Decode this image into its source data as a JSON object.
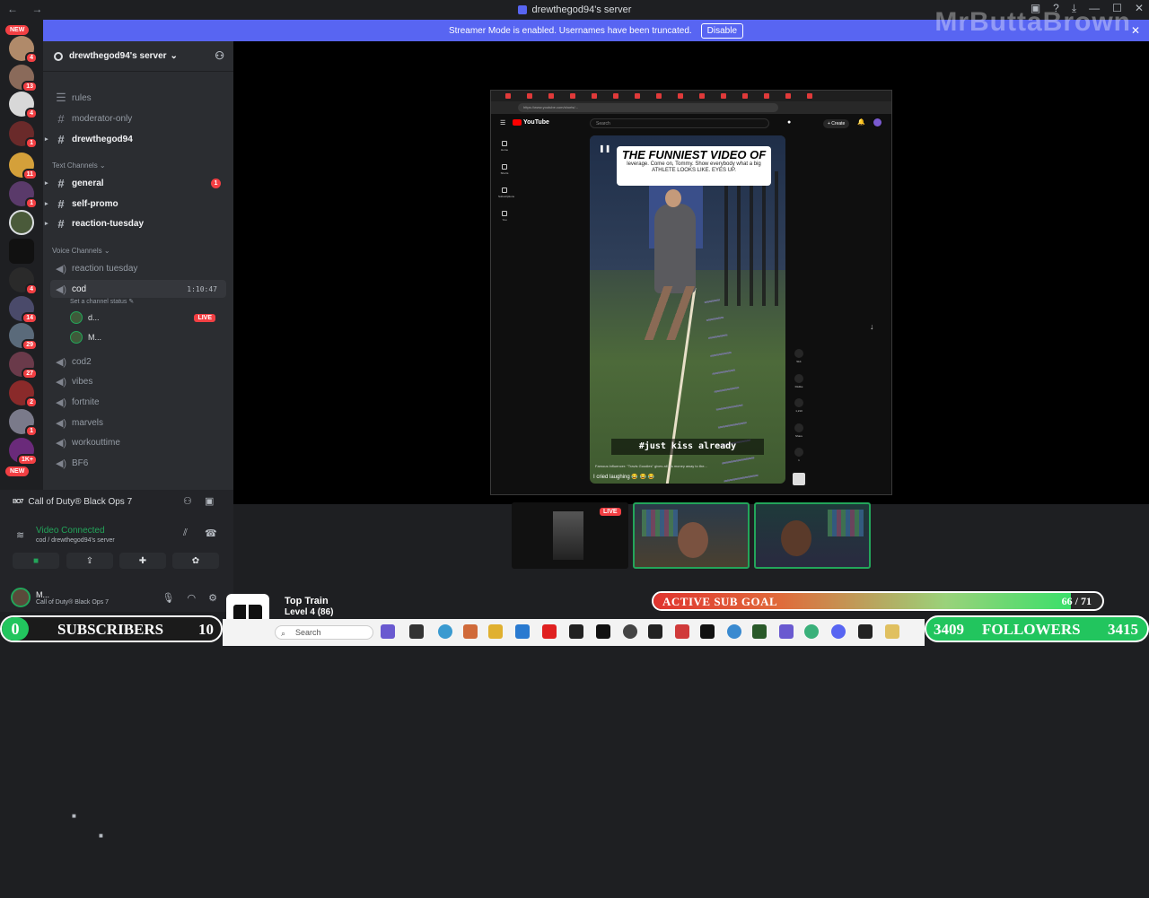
{
  "window": {
    "title": "drewthegod94's server",
    "nav": "← →",
    "controls": [
      "▣",
      "?",
      "⤓",
      "—",
      "☐",
      "✕"
    ]
  },
  "banner": {
    "text": "Streamer Mode is enabled. Usernames have been truncated.",
    "button": "Disable",
    "close": "✕",
    "watermark": "MrButtaBrown"
  },
  "rail": {
    "new_top": "NEW",
    "new_bottom": "NEW",
    "badges": [
      "4",
      "13",
      "4",
      "1",
      "11",
      "1",
      "4",
      "14",
      "29",
      "27",
      "2",
      "1",
      "1K+"
    ]
  },
  "sidebar": {
    "server_name": "drewthegod94's server",
    "server_chevron": "⌄",
    "channels_top": [
      {
        "name": "rules",
        "icon": "☰"
      },
      {
        "name": "moderator-only",
        "icon": "#"
      },
      {
        "name": "drewthegod94",
        "icon": "#"
      }
    ],
    "text_category": "Text Channels",
    "text_channels": [
      {
        "name": "general",
        "unread": "1"
      },
      {
        "name": "self-promo"
      },
      {
        "name": "reaction-tuesday"
      }
    ],
    "voice_category": "Voice Channels",
    "voice_channels": [
      "reaction tuesday",
      "cod",
      "cod2",
      "vibes",
      "fortnite",
      "marvels",
      "workouttime",
      "BF6"
    ],
    "cod_time": "1:10:47",
    "cod_status": "Set a channel status",
    "voice_users": [
      {
        "name": "d...",
        "live": "LIVE"
      },
      {
        "name": "M..."
      }
    ]
  },
  "voice_panel": {
    "activity": "Call of Duty® Black Ops 7",
    "activity_logo": "BO7",
    "status": "Video Connected",
    "sub": "cod / drewthegod94's server",
    "user_name": "M...",
    "user_sub": "Call of Duty® Black Ops 7"
  },
  "browser": {
    "url": "https://www.youtube.com/shorts/...",
    "yt_brand": "YouTube",
    "search_placeholder": "Search",
    "create": "+ Create",
    "side": [
      "Home",
      "Shorts",
      "Subscriptions",
      "You"
    ],
    "short_title": "THE FUNNIEST VIDEO OF",
    "short_subtitle": "leverage. Come on, Tommy. Show everybody what a big ATHLETE LOOKS LIKE. EYES UP.",
    "short_hashtag": "#just kiss already",
    "short_caption": "Famous Influencer: \"Travis Goodies\" gives all his money away to the...",
    "short_caption2": "I cried laughing 😂 😂 😂",
    "actions": [
      "51K",
      "Dislike",
      "1,210",
      "Share",
      "1"
    ]
  },
  "webcams": {
    "live": "LIVE"
  },
  "overlay": {
    "sub_goal_label": "ACTIVE SUB GOAL",
    "sub_goal_current": "66",
    "sub_goal_target": "71",
    "sub_goal_text": "66 / 71",
    "sub_goal_fraction": 0.93,
    "subs_left": "0",
    "subs_label": "SUBSCRIBERS",
    "subs_right": "10",
    "followers_left": "3409",
    "followers_label": "FOLLOWERS",
    "followers_right": "3415"
  },
  "train": {
    "title": "Top Train",
    "level": "Level 4 (86)"
  },
  "taskbar": {
    "search": "Search"
  },
  "colors": {
    "discord_blurple": "#5865f2",
    "online_green": "#23a55a",
    "notification_red": "#f23f43"
  }
}
